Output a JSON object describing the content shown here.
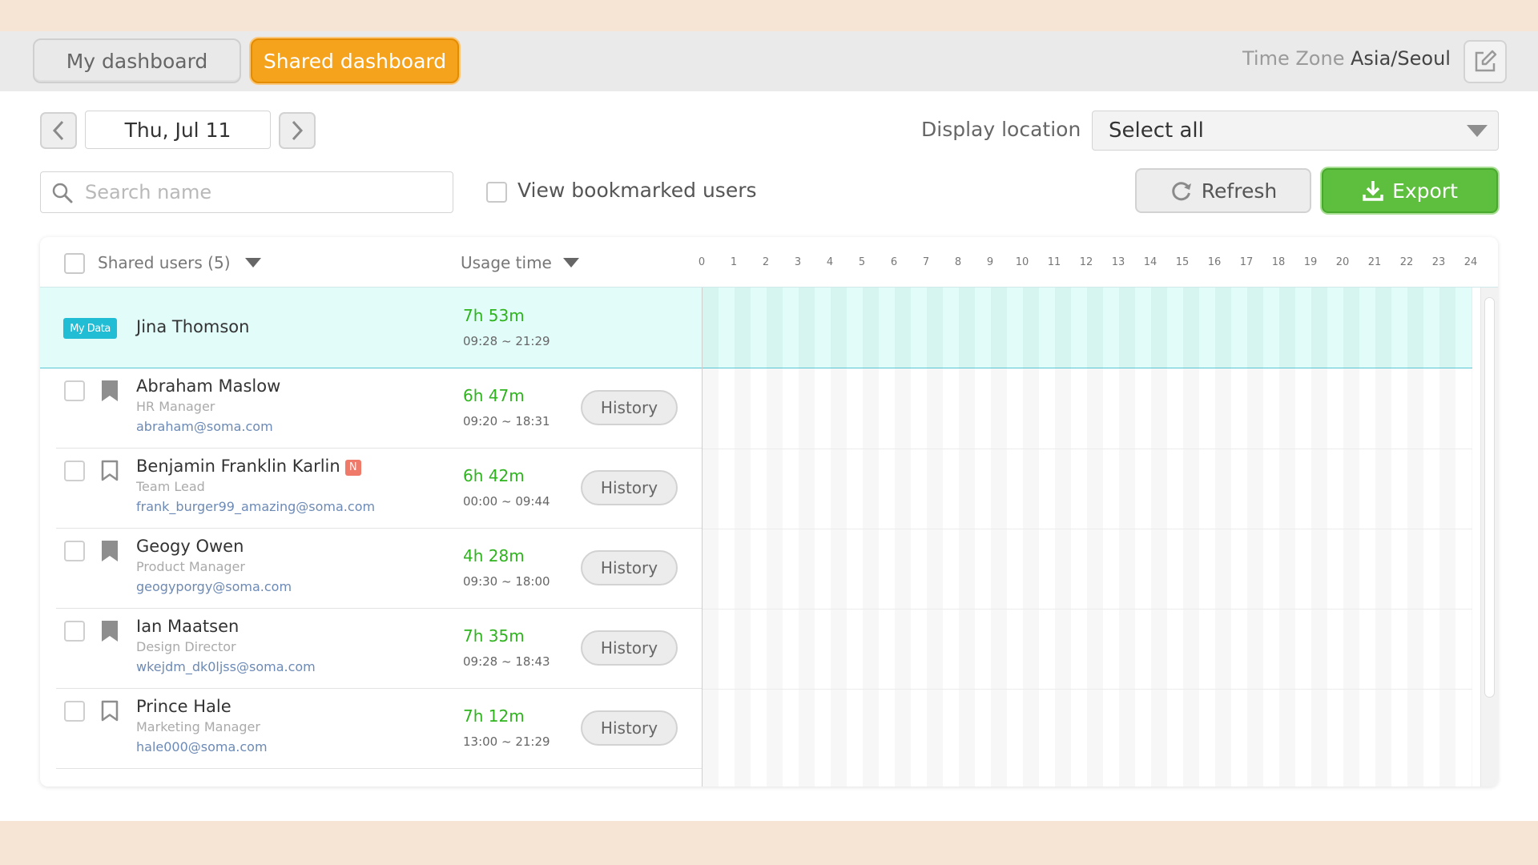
{
  "tabs": {
    "my_dashboard": "My dashboard",
    "shared_dashboard": "Shared dashboard"
  },
  "timezone": {
    "label": "Time Zone",
    "value": "Asia/Seoul"
  },
  "date": {
    "current": "Thu, Jul 11"
  },
  "display_location": {
    "label": "Display location",
    "selected": "Select all"
  },
  "search": {
    "placeholder": "Search name"
  },
  "bookmark_filter": {
    "label": "View bookmarked users",
    "checked": false
  },
  "actions": {
    "refresh": "Refresh",
    "export": "Export"
  },
  "table": {
    "users_header": "Shared users (5)",
    "usage_header": "Usage time",
    "hours": [
      "0",
      "1",
      "2",
      "3",
      "4",
      "5",
      "6",
      "7",
      "8",
      "9",
      "10",
      "11",
      "12",
      "13",
      "14",
      "15",
      "16",
      "17",
      "18",
      "19",
      "20",
      "21",
      "22",
      "23",
      "24"
    ],
    "history_label": "History",
    "my_data": {
      "badge": "My Data",
      "name": "Jina Thomson",
      "duration": "7h 53m",
      "range": "09:28 ~ 21:29"
    },
    "users": [
      {
        "name": "Abraham Maslow",
        "role": "HR Manager",
        "email": "abraham@soma.com",
        "duration": "6h 47m",
        "range": "09:20 ~ 18:31",
        "bookmarked": true,
        "new": false
      },
      {
        "name": "Benjamin Franklin Karlin",
        "role": "Team Lead",
        "email": "frank_burger99_amazing@soma.com",
        "duration": "6h 42m",
        "range": "00:00 ~ 09:44",
        "bookmarked": false,
        "new": true,
        "new_badge": "N"
      },
      {
        "name": "Geogy Owen",
        "role": "Product Manager",
        "email": "geogyporgy@soma.com",
        "duration": "4h 28m",
        "range": "09:30 ~ 18:00",
        "bookmarked": true,
        "new": false
      },
      {
        "name": "Ian Maatsen",
        "role": "Design Director",
        "email": "wkejdm_dk0ljss@soma.com",
        "duration": "7h 35m",
        "range": "09:28 ~ 18:43",
        "bookmarked": true,
        "new": false
      },
      {
        "name": "Prince Hale",
        "role": "Marketing Manager",
        "email": "hale000@soma.com",
        "duration": "7h 12m",
        "range": "13:00 ~ 21:29",
        "bookmarked": false,
        "new": false
      }
    ]
  },
  "colors": {
    "accent_orange": "#f5a21d",
    "export_green": "#5dbf3d",
    "duration_green": "#2fb31e",
    "my_data_cyan": "#21bdd5",
    "page_bg": "#f6e5d5"
  }
}
